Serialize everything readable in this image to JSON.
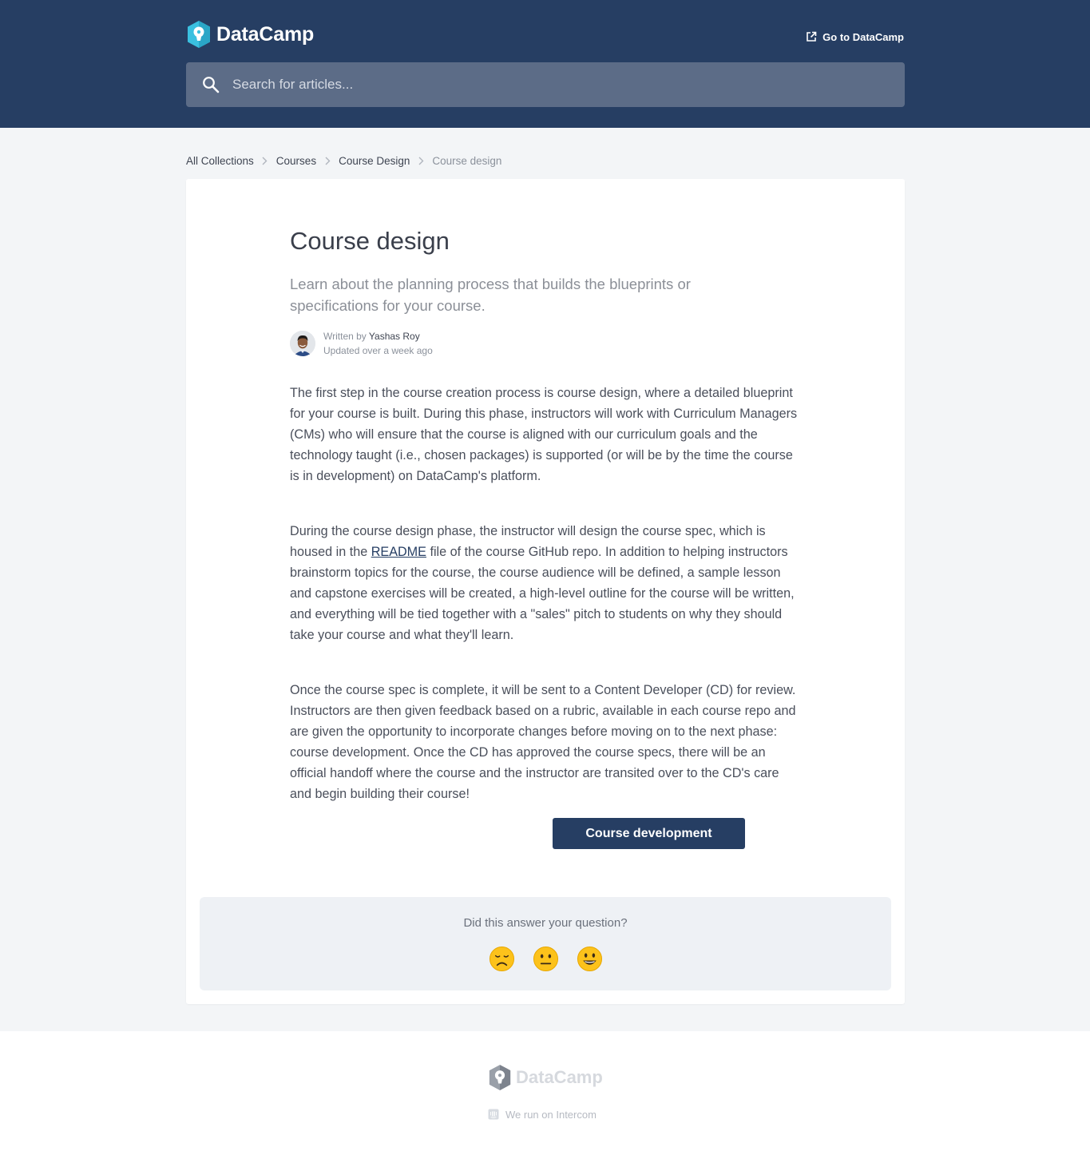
{
  "header": {
    "brand": "DataCamp",
    "goto_label": "Go to DataCamp",
    "search_placeholder": "Search for articles..."
  },
  "breadcrumb": {
    "items": [
      "All Collections",
      "Courses",
      "Course Design"
    ],
    "current": "Course design"
  },
  "article": {
    "title": "Course design",
    "subtitle": "Learn about the planning process that builds the blueprints or specifications for your course.",
    "author": {
      "written_by": "Written by",
      "name": "Yashas Roy",
      "updated": "Updated over a week ago"
    },
    "paragraphs": [
      "The first step in the course creation process is course design, where a detailed blueprint for your course is built. During this phase, instructors will work with Curriculum Managers (CMs) who will ensure that the course is aligned with our curriculum goals and the technology taught (i.e., chosen packages) is supported (or will be by the time the course is in development) on DataCamp's platform.",
      {
        "before": "During the course design phase, the instructor will design the course spec, which is housed in the ",
        "link": "README",
        "after": " file of the course GitHub repo. In addition to helping instructors brainstorm topics for the course, the course audience will be defined, a sample lesson and capstone exercises will be created, a high-level outline for the course will be written, and everything will be tied together with a \"sales\" pitch to students on why they should take your course and what they'll learn."
      },
      "Once the course spec is complete, it will be sent to a Content Developer (CD) for review. Instructors are then given feedback based on a rubric, available in each course repo and are given the opportunity to incorporate changes before moving on to the next phase: course development. Once the CD has approved the course specs, there will be an official handoff where the course and the instructor are transited over to the CD's care and begin building their course!"
    ],
    "cta_label": "Course development"
  },
  "feedback": {
    "question": "Did this answer your question?",
    "reactions": [
      "disappointed-face-icon",
      "neutral-face-icon",
      "smiley-face-icon"
    ]
  },
  "footer": {
    "brand": "DataCamp",
    "powered_by": "We run on Intercom"
  },
  "colors": {
    "header_bg": "#263e63",
    "search_bg": "#5c6c87",
    "page_bg": "#f3f5f7",
    "feedback_bg": "#eef1f5",
    "logo_teal": "#3ac0e0"
  }
}
